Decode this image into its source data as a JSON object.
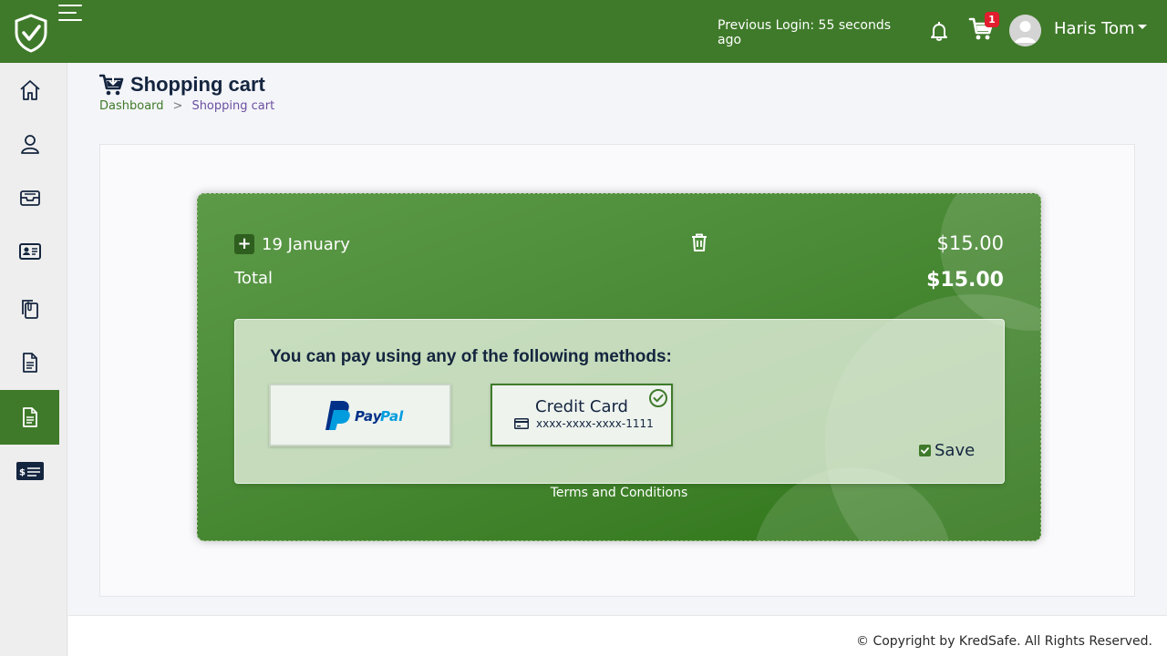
{
  "header": {
    "previous_login": "Previous Login: 55 seconds ago",
    "cart_count": "1",
    "user_name": "Haris Tom",
    "brand_color": "#3f7a2a"
  },
  "sidebar": {
    "items": [
      {
        "icon": "home-icon"
      },
      {
        "icon": "user-icon"
      },
      {
        "icon": "inbox-tray-icon"
      },
      {
        "icon": "id-card-icon"
      },
      {
        "icon": "documents-clip-icon"
      },
      {
        "icon": "document-icon"
      },
      {
        "icon": "document-active-icon",
        "active": true
      },
      {
        "icon": "payment-card-icon"
      }
    ]
  },
  "page": {
    "title": "Shopping cart",
    "breadcrumb": {
      "home": "Dashboard",
      "separator": ">",
      "current": "Shopping cart"
    }
  },
  "cart": {
    "item_label": "19 January",
    "item_price": "$15.00",
    "total_label": "Total",
    "total_value": "$15.00",
    "pay_title": "You can pay using any of the following methods:",
    "methods": {
      "paypal": {
        "label": "PayPal"
      },
      "card": {
        "title": "Credit Card",
        "number": "xxxx-xxxx-xxxx-1111",
        "selected": true
      }
    },
    "save_label": "Save",
    "save_checked": true,
    "terms": "Terms and Conditions"
  },
  "footer": {
    "copyright": "© Copyright by KredSafe. All Rights Reserved."
  }
}
